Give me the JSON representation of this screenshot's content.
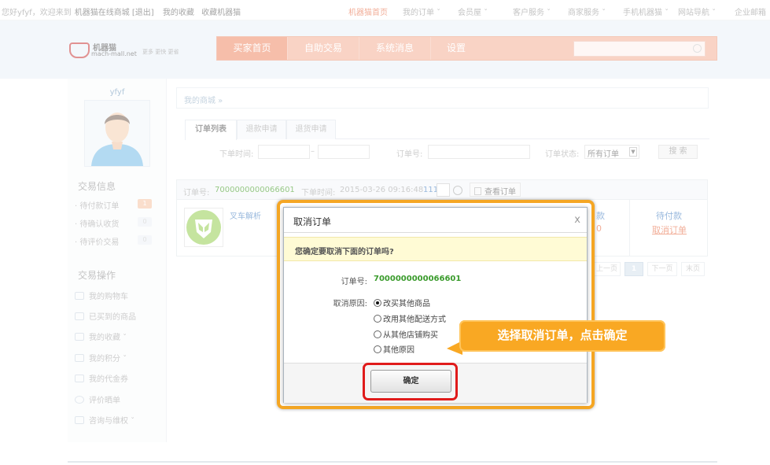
{
  "topbar": {
    "greeting": "您好yfyf，欢迎来到",
    "site_name": "机器猫在线商城",
    "logout": "[退出]",
    "my_collection": "我的收藏",
    "collect_site": "收藏机器猫",
    "nav": [
      {
        "label": "机器猫首页",
        "dropdown": false,
        "highlight": true
      },
      {
        "label": "我的订单",
        "dropdown": true
      },
      {
        "label": "会员屋",
        "dropdown": true
      },
      {
        "label": "客户服务",
        "dropdown": true
      },
      {
        "label": "商家服务",
        "dropdown": true
      },
      {
        "label": "手机机器猫",
        "dropdown": true
      },
      {
        "label": "网站导航",
        "dropdown": true
      },
      {
        "label": "企业邮箱",
        "dropdown": false
      }
    ]
  },
  "logo": {
    "name": "机器猫",
    "url": "mach-mall.net",
    "slogan": "更多 更快 更省"
  },
  "main_nav": {
    "items": [
      "买家首页",
      "自助交易",
      "系统消息",
      "设置"
    ],
    "active_index": 0,
    "search_placeholder": ""
  },
  "sidebar": {
    "username": "yfyf",
    "trade_info_title": "交易信息",
    "trade_info": [
      {
        "label": "待付款订单",
        "count": "1",
        "hot": true
      },
      {
        "label": "待确认收货",
        "count": "0",
        "hot": false
      },
      {
        "label": "待评价交易",
        "count": "0",
        "hot": false
      }
    ],
    "ops_title": "交易操作",
    "ops": [
      {
        "label": "我的购物车",
        "icon": "cart-icon",
        "dropdown": false
      },
      {
        "label": "已买到的商品",
        "icon": "basket-icon",
        "dropdown": false
      },
      {
        "label": "我的收藏",
        "icon": "trophy-icon",
        "dropdown": true
      },
      {
        "label": "我的积分",
        "icon": "calendar-icon",
        "dropdown": true
      },
      {
        "label": "我的代金券",
        "icon": "gift-icon",
        "dropdown": false
      },
      {
        "label": "评价晒单",
        "icon": "heart-icon",
        "dropdown": false
      },
      {
        "label": "咨询与维权",
        "icon": "scale-icon",
        "dropdown": true
      }
    ]
  },
  "content": {
    "breadcrumb": "我的商城 »",
    "tabs": [
      "订单列表",
      "退款申请",
      "退货申请"
    ],
    "active_tab": 0,
    "filter": {
      "order_time_label": "下单时间:",
      "dash": "–",
      "order_no_label": "订单号:",
      "status_label": "订单状态:",
      "status_value": "所有订单",
      "search_btn": "搜 索"
    },
    "order": {
      "no_label": "订单号:",
      "no": "7000000000066601",
      "time_label": "下单时间:",
      "time": "2015-03-26 09:16:48",
      "num_fragment": "111",
      "view_order": "查看订单",
      "product_name": "叉车解析",
      "price_fragment": "款",
      "price_frag2": "0",
      "status": "待付款",
      "cancel_link": "取消订单"
    },
    "pager": {
      "prev": "上一页",
      "current": "1",
      "next": "下一页",
      "last": "末页"
    }
  },
  "dialog": {
    "title": "取消订单",
    "close": "x",
    "warning": "您确定要取消下面的订单吗?",
    "order_no_label": "订单号:",
    "order_no": "7000000000066601",
    "reason_label": "取消原因:",
    "reasons": [
      "改买其他商品",
      "改用其他配送方式",
      "从其他店铺购买",
      "其他原因"
    ],
    "selected_reason": 0,
    "confirm": "确定"
  },
  "callout": {
    "text": "选择取消订单，点击确定"
  },
  "colors": {
    "accent": "#ef8f6d",
    "callout": "#f9a823",
    "highlight_ring": "#e01b1b",
    "order_no": "#3a9b2c"
  }
}
